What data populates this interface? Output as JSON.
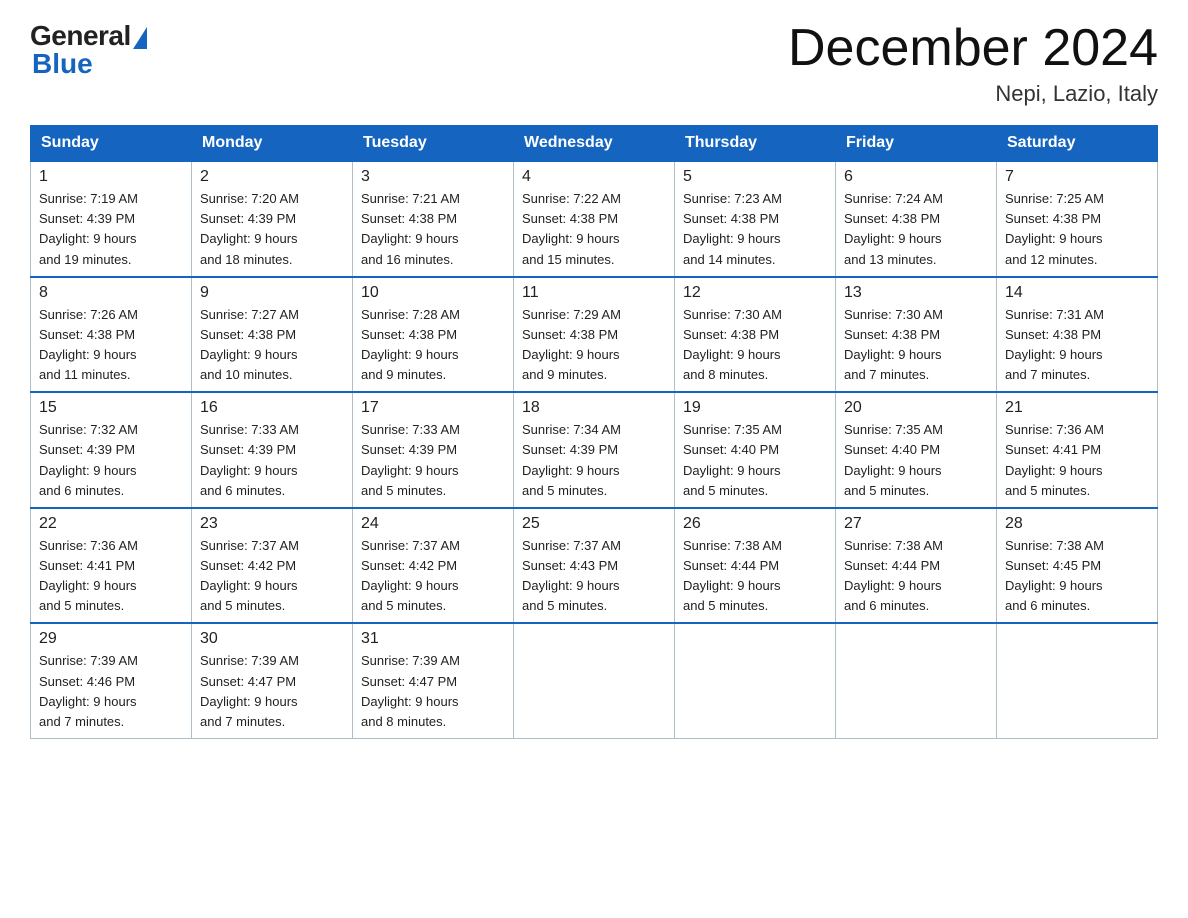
{
  "logo": {
    "general": "General",
    "blue": "Blue"
  },
  "title": "December 2024",
  "location": "Nepi, Lazio, Italy",
  "days_of_week": [
    "Sunday",
    "Monday",
    "Tuesday",
    "Wednesday",
    "Thursday",
    "Friday",
    "Saturday"
  ],
  "weeks": [
    [
      {
        "day": "1",
        "sunrise": "7:19 AM",
        "sunset": "4:39 PM",
        "daylight": "9 hours and 19 minutes."
      },
      {
        "day": "2",
        "sunrise": "7:20 AM",
        "sunset": "4:39 PM",
        "daylight": "9 hours and 18 minutes."
      },
      {
        "day": "3",
        "sunrise": "7:21 AM",
        "sunset": "4:38 PM",
        "daylight": "9 hours and 16 minutes."
      },
      {
        "day": "4",
        "sunrise": "7:22 AM",
        "sunset": "4:38 PM",
        "daylight": "9 hours and 15 minutes."
      },
      {
        "day": "5",
        "sunrise": "7:23 AM",
        "sunset": "4:38 PM",
        "daylight": "9 hours and 14 minutes."
      },
      {
        "day": "6",
        "sunrise": "7:24 AM",
        "sunset": "4:38 PM",
        "daylight": "9 hours and 13 minutes."
      },
      {
        "day": "7",
        "sunrise": "7:25 AM",
        "sunset": "4:38 PM",
        "daylight": "9 hours and 12 minutes."
      }
    ],
    [
      {
        "day": "8",
        "sunrise": "7:26 AM",
        "sunset": "4:38 PM",
        "daylight": "9 hours and 11 minutes."
      },
      {
        "day": "9",
        "sunrise": "7:27 AM",
        "sunset": "4:38 PM",
        "daylight": "9 hours and 10 minutes."
      },
      {
        "day": "10",
        "sunrise": "7:28 AM",
        "sunset": "4:38 PM",
        "daylight": "9 hours and 9 minutes."
      },
      {
        "day": "11",
        "sunrise": "7:29 AM",
        "sunset": "4:38 PM",
        "daylight": "9 hours and 9 minutes."
      },
      {
        "day": "12",
        "sunrise": "7:30 AM",
        "sunset": "4:38 PM",
        "daylight": "9 hours and 8 minutes."
      },
      {
        "day": "13",
        "sunrise": "7:30 AM",
        "sunset": "4:38 PM",
        "daylight": "9 hours and 7 minutes."
      },
      {
        "day": "14",
        "sunrise": "7:31 AM",
        "sunset": "4:38 PM",
        "daylight": "9 hours and 7 minutes."
      }
    ],
    [
      {
        "day": "15",
        "sunrise": "7:32 AM",
        "sunset": "4:39 PM",
        "daylight": "9 hours and 6 minutes."
      },
      {
        "day": "16",
        "sunrise": "7:33 AM",
        "sunset": "4:39 PM",
        "daylight": "9 hours and 6 minutes."
      },
      {
        "day": "17",
        "sunrise": "7:33 AM",
        "sunset": "4:39 PM",
        "daylight": "9 hours and 5 minutes."
      },
      {
        "day": "18",
        "sunrise": "7:34 AM",
        "sunset": "4:39 PM",
        "daylight": "9 hours and 5 minutes."
      },
      {
        "day": "19",
        "sunrise": "7:35 AM",
        "sunset": "4:40 PM",
        "daylight": "9 hours and 5 minutes."
      },
      {
        "day": "20",
        "sunrise": "7:35 AM",
        "sunset": "4:40 PM",
        "daylight": "9 hours and 5 minutes."
      },
      {
        "day": "21",
        "sunrise": "7:36 AM",
        "sunset": "4:41 PM",
        "daylight": "9 hours and 5 minutes."
      }
    ],
    [
      {
        "day": "22",
        "sunrise": "7:36 AM",
        "sunset": "4:41 PM",
        "daylight": "9 hours and 5 minutes."
      },
      {
        "day": "23",
        "sunrise": "7:37 AM",
        "sunset": "4:42 PM",
        "daylight": "9 hours and 5 minutes."
      },
      {
        "day": "24",
        "sunrise": "7:37 AM",
        "sunset": "4:42 PM",
        "daylight": "9 hours and 5 minutes."
      },
      {
        "day": "25",
        "sunrise": "7:37 AM",
        "sunset": "4:43 PM",
        "daylight": "9 hours and 5 minutes."
      },
      {
        "day": "26",
        "sunrise": "7:38 AM",
        "sunset": "4:44 PM",
        "daylight": "9 hours and 5 minutes."
      },
      {
        "day": "27",
        "sunrise": "7:38 AM",
        "sunset": "4:44 PM",
        "daylight": "9 hours and 6 minutes."
      },
      {
        "day": "28",
        "sunrise": "7:38 AM",
        "sunset": "4:45 PM",
        "daylight": "9 hours and 6 minutes."
      }
    ],
    [
      {
        "day": "29",
        "sunrise": "7:39 AM",
        "sunset": "4:46 PM",
        "daylight": "9 hours and 7 minutes."
      },
      {
        "day": "30",
        "sunrise": "7:39 AM",
        "sunset": "4:47 PM",
        "daylight": "9 hours and 7 minutes."
      },
      {
        "day": "31",
        "sunrise": "7:39 AM",
        "sunset": "4:47 PM",
        "daylight": "9 hours and 8 minutes."
      },
      null,
      null,
      null,
      null
    ]
  ],
  "labels": {
    "sunrise": "Sunrise:",
    "sunset": "Sunset:",
    "daylight": "Daylight:"
  }
}
